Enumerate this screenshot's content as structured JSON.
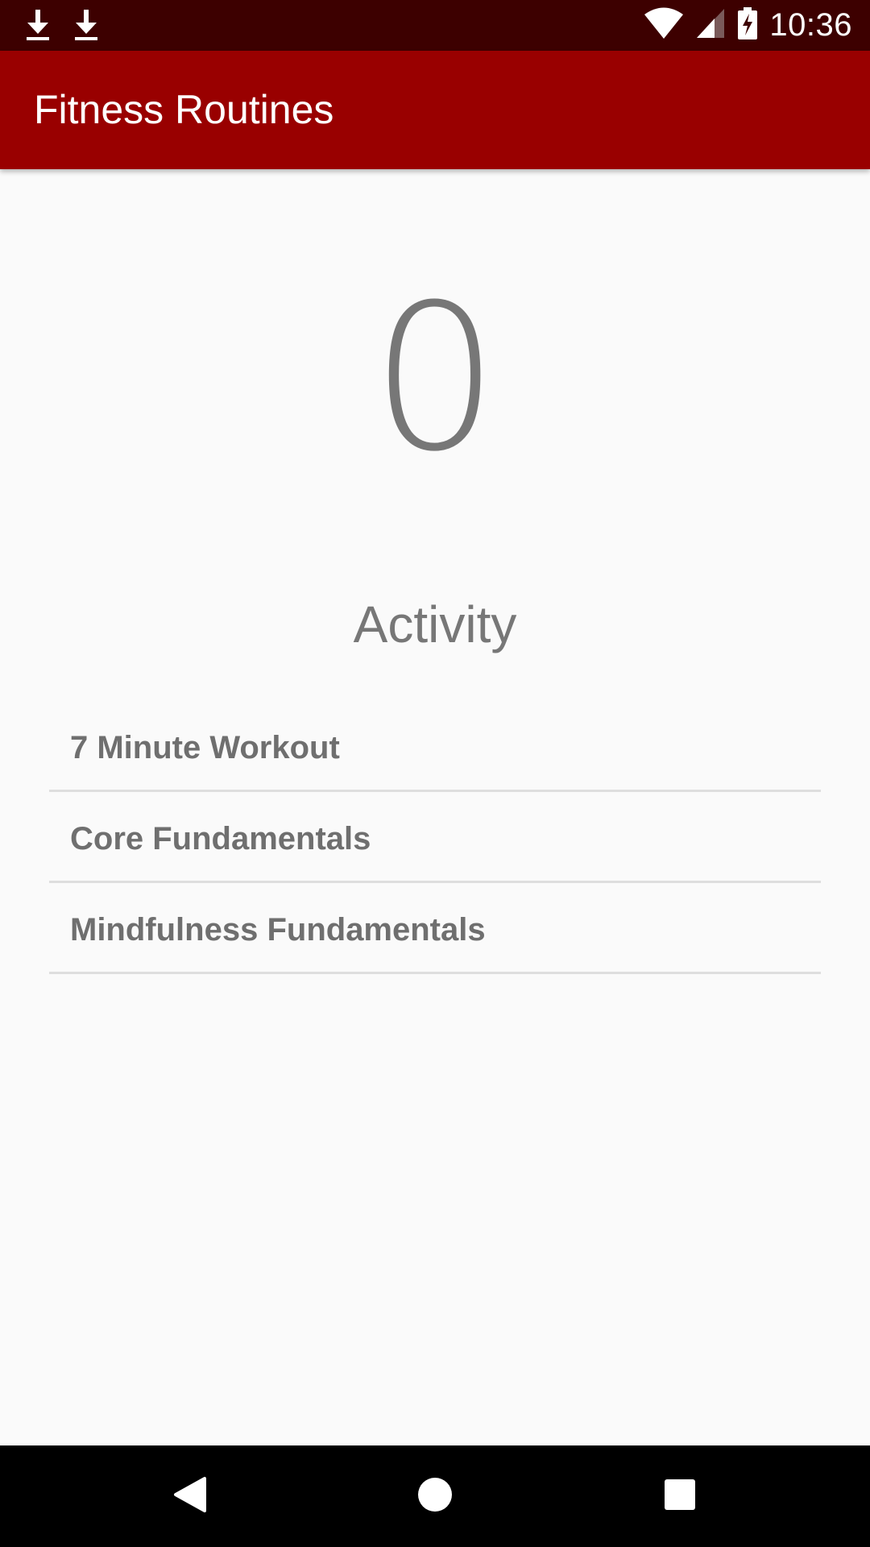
{
  "status_bar": {
    "time": "10:36",
    "icons": [
      "download-icon",
      "download-icon",
      "wifi-icon",
      "cell-signal-icon",
      "battery-charging-icon"
    ]
  },
  "app_bar": {
    "title": "Fitness Routines"
  },
  "main": {
    "counter_value": "0",
    "section_label": "Activity",
    "routines": [
      {
        "label": "7 Minute Workout"
      },
      {
        "label": "Core Fundamentals"
      },
      {
        "label": "Mindfulness Fundamentals"
      }
    ]
  },
  "nav_bar": {
    "buttons": [
      "back-icon",
      "home-icon",
      "recents-icon"
    ]
  },
  "colors": {
    "app_bar": "#990000",
    "status_bar": "#3d0000",
    "text_muted": "#777777",
    "background": "#fafafa"
  }
}
